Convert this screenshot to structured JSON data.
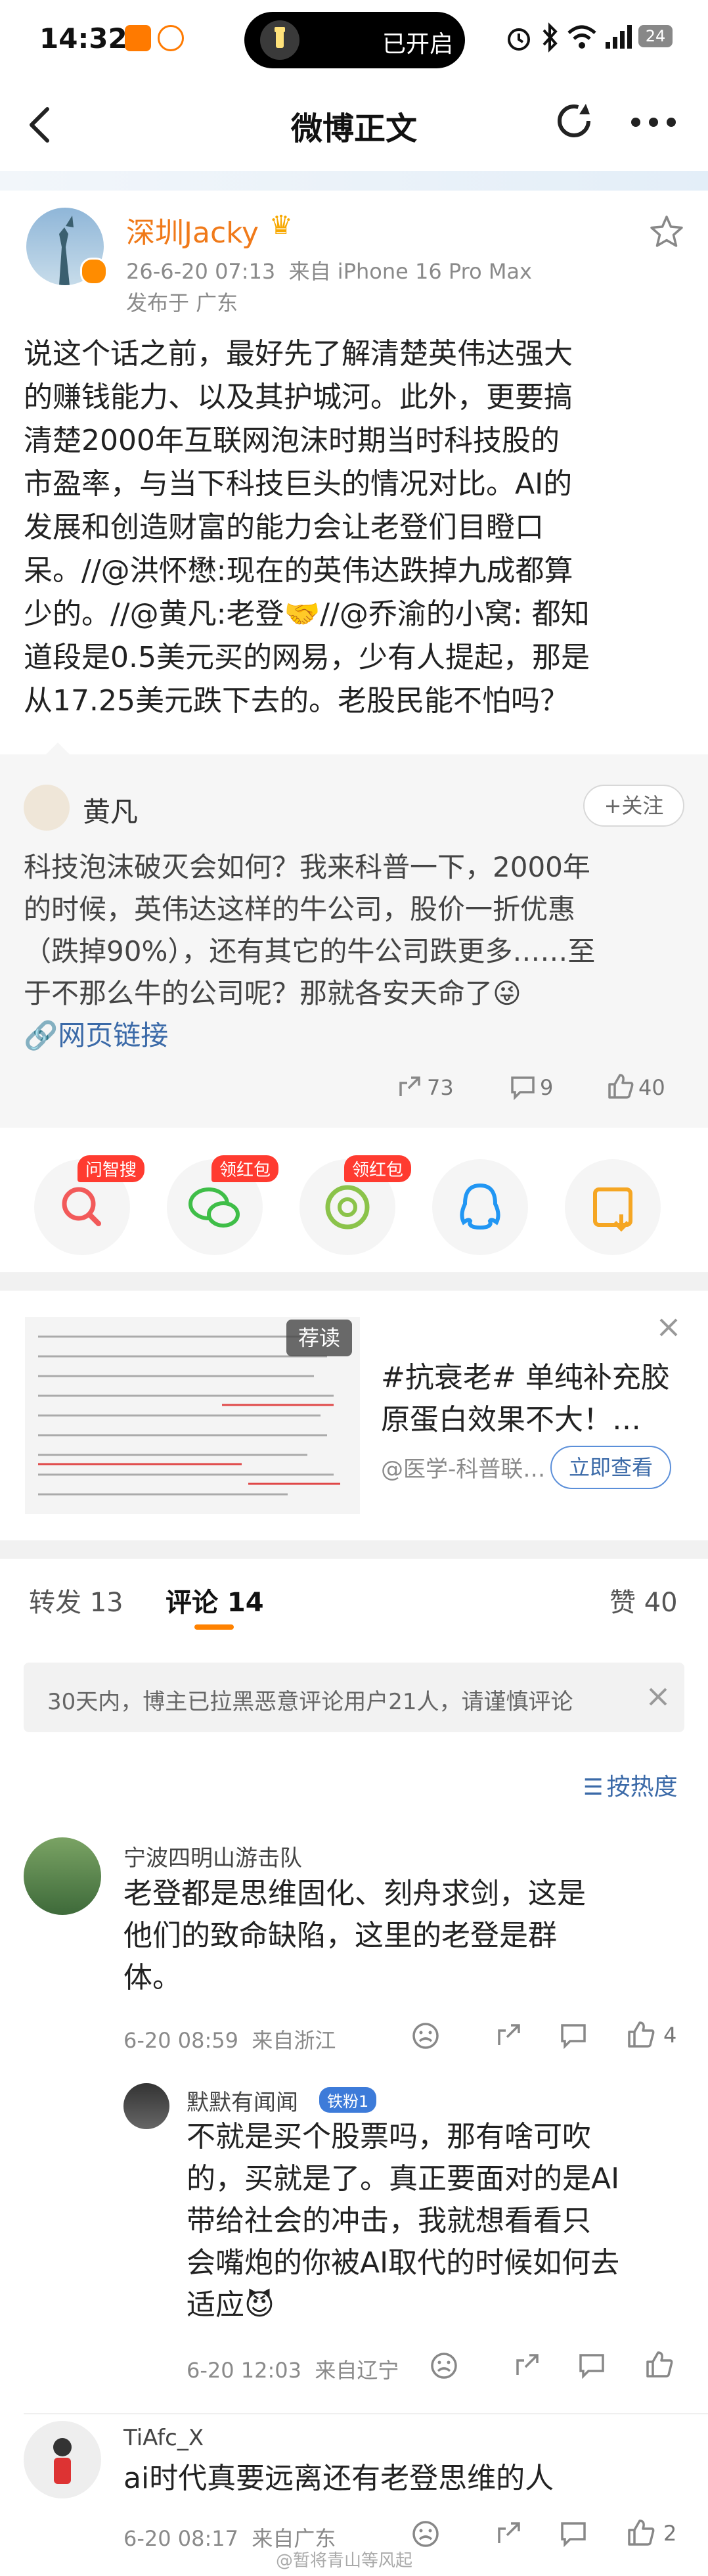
{
  "status": {
    "time": "14:32",
    "pill_text": "已开启",
    "battery": "24"
  },
  "nav": {
    "title": "微博正文"
  },
  "post": {
    "author": "深圳Jacky",
    "time_device": "26-6-20 07:13  来自 iPhone 16 Pro Max",
    "location": "发布于 广东",
    "text_lines": [
      "说这个话之前，最好先了解清楚英伟达强大",
      "的赚钱能力、以及其护城河。此外，更要搞",
      "清楚2000年互联网泡沫时期当时科技股的",
      "市盈率，与当下科技巨头的情况对比。AI的",
      "发展和创造财富的能力会让老登们目瞪口",
      "呆。//@洪怀懋:现在的英伟达跌掉九成都算",
      "少的。//@黄凡:老登🤝//@乔渝的小窝: 都知",
      "道段是0.5美元买的网易，少有人提起，那是",
      "从17.25美元跌下去的。老股民能不怕吗？"
    ]
  },
  "repost": {
    "author": "黄凡",
    "follow_label": "+关注",
    "text_lines": [
      "科技泡沫破灭会如何？我来科普一下，2000年",
      "的时候，英伟达这样的牛公司，股价一折优惠",
      "（跌掉90%），还有其它的牛公司跌更多……至",
      "于不那么牛的公司呢？那就各安天命了😜"
    ],
    "link_label": "🔗网页链接",
    "reposts": "73",
    "comments": "9",
    "likes": "40"
  },
  "share_bar": {
    "items": [
      {
        "icon": "search-icon",
        "chip": "问智搜",
        "color": "#f25a5a"
      },
      {
        "icon": "wechat-icon",
        "chip": "领红包",
        "color": "#3fbe48"
      },
      {
        "icon": "moments-icon",
        "chip": "领红包",
        "color": "#8bc34a"
      },
      {
        "icon": "qq-icon",
        "chip": "",
        "color": "#2196f3"
      },
      {
        "icon": "save-image-icon",
        "chip": "",
        "color": "#f5a623"
      }
    ]
  },
  "recommend": {
    "tag": "荐读",
    "title_line1": "#抗衰老# 单纯补充胶",
    "title_line2": "原蛋白效果不大！…",
    "source": "@医学-科普联…",
    "button": "立即查看"
  },
  "tabs": {
    "repost": "转发 13",
    "comment": "评论 14",
    "like": "赞 40"
  },
  "notice": "30天内，博主已拉黑恶意评论用户21人，请谨慎评论",
  "sort_label": "按热度",
  "comments": [
    {
      "name": "宁波四明山游击队",
      "lines": [
        "老登都是思维固化、刻舟求剑，这是",
        "他们的致命缺陷，这里的老登是群",
        "体。"
      ],
      "time": "6-20 08:59  来自浙江",
      "likes": "4",
      "reply": {
        "name": "默默有闻闻",
        "badge": "铁粉1",
        "lines": [
          "不就是买个股票吗，那有啥可吹",
          "的，买就是了。真正要面对的是AI",
          "带给社会的冲击，我就想看看只",
          "会嘴炮的你被AI取代的时候如何去",
          "适应😈"
        ],
        "time": "6-20 12:03  来自辽宁",
        "likes": ""
      }
    },
    {
      "name": "TiAfc_X",
      "lines": [
        "ai时代真要远离还有老登思维的人"
      ],
      "time": "6-20 08:17  来自广东",
      "likes": "2"
    }
  ],
  "watermark": "@暂将青山等风起"
}
